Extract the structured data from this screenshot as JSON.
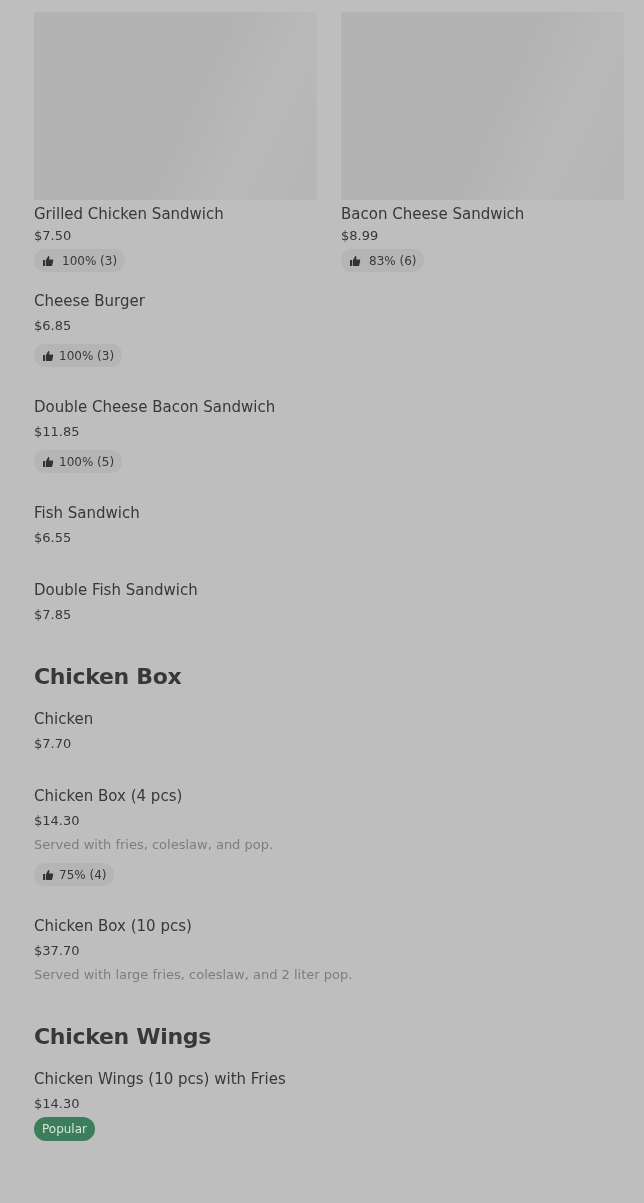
{
  "featured": [
    {
      "name": "Grilled Chicken Sandwich",
      "price": "$7.50",
      "rating": "100% (3)"
    },
    {
      "name": "Bacon Cheese Sandwich",
      "price": "$8.99",
      "rating": "83% (6)"
    }
  ],
  "items": [
    {
      "name": "Cheese Burger",
      "price": "$6.85",
      "rating": "100% (3)"
    },
    {
      "name": "Double Cheese Bacon Sandwich",
      "price": "$11.85",
      "rating": "100% (5)"
    },
    {
      "name": "Fish Sandwich",
      "price": "$6.55"
    },
    {
      "name": "Double Fish Sandwich",
      "price": "$7.85"
    }
  ],
  "sections": [
    {
      "heading": "Chicken Box",
      "items": [
        {
          "name": "Chicken",
          "price": "$7.70"
        },
        {
          "name": "Chicken Box (4 pcs)",
          "price": "$14.30",
          "description": "Served with fries, coleslaw, and pop.",
          "rating": "75% (4)"
        },
        {
          "name": "Chicken Box (10 pcs)",
          "price": "$37.70",
          "description": "Served with large fries, coleslaw, and 2 liter pop."
        }
      ]
    },
    {
      "heading": "Chicken Wings",
      "items": [
        {
          "name": "Chicken Wings (10 pcs) with Fries",
          "price": "$14.30",
          "badge": "Popular"
        }
      ]
    }
  ]
}
